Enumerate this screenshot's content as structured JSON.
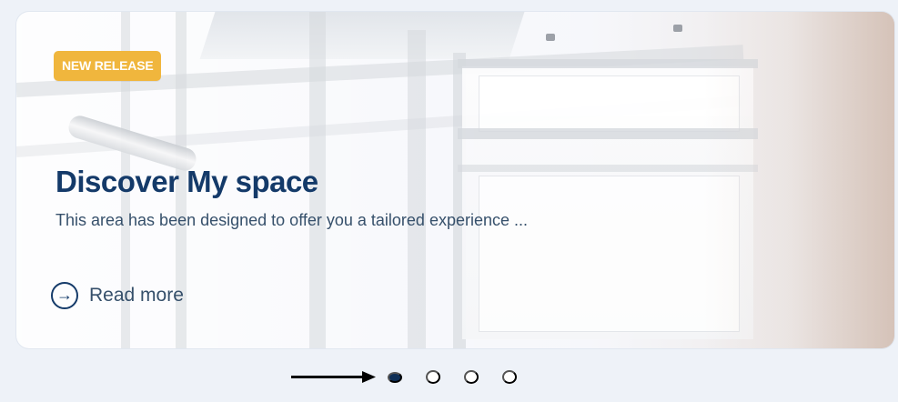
{
  "hero": {
    "badge": "NEW RELEASE",
    "title": "Discover My space",
    "description": "This area has been designed to offer you a tailored experience ...",
    "cta_label": "Read more"
  },
  "carousel": {
    "dots": [
      {
        "active": true
      },
      {
        "active": false
      },
      {
        "active": false
      },
      {
        "active": false
      }
    ]
  },
  "icons": {
    "read_more": "arrow-right-circle-icon",
    "annotation_arrow": "arrow-right-icon"
  },
  "colors": {
    "badge": "#f0b63d",
    "title": "#143a69",
    "text": "#36506b",
    "background": "#eef2f8",
    "active_dot": "#0f2f57",
    "inactive_dot": "#ffffff"
  }
}
